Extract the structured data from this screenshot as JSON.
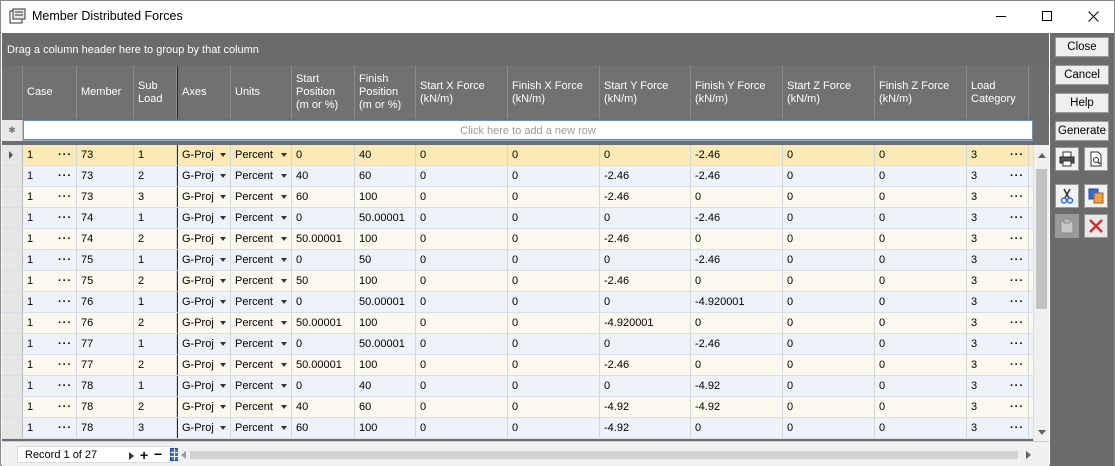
{
  "window": {
    "title": "Member Distributed Forces",
    "min_label": "—",
    "max_label": "☐",
    "close_label": "✕"
  },
  "grid": {
    "group_hint": "Drag a column header here to group by that column",
    "new_row_hint": "Click here to add a new row",
    "columns": [
      "Case",
      "Member",
      "Sub\nLoad",
      "Axes",
      "Units",
      "Start\nPosition\n(m or %)",
      "Finish\nPosition\n(m or %)",
      "Start X Force\n(kN/m)",
      "Finish X Force\n(kN/m)",
      "Start Y Force\n(kN/m)",
      "Finish Y Force\n(kN/m)",
      "Start Z Force\n(kN/m)",
      "Finish Z Force\n(kN/m)",
      "Load\nCategory"
    ],
    "rows": [
      [
        "1",
        "73",
        "1",
        "G-Proj",
        "Percent",
        "0",
        "40",
        "0",
        "0",
        "0",
        "-2.46",
        "0",
        "0",
        "3"
      ],
      [
        "1",
        "73",
        "2",
        "G-Proj",
        "Percent",
        "40",
        "60",
        "0",
        "0",
        "-2.46",
        "-2.46",
        "0",
        "0",
        "3"
      ],
      [
        "1",
        "73",
        "3",
        "G-Proj",
        "Percent",
        "60",
        "100",
        "0",
        "0",
        "-2.46",
        "0",
        "0",
        "0",
        "3"
      ],
      [
        "1",
        "74",
        "1",
        "G-Proj",
        "Percent",
        "0",
        "50.00001",
        "0",
        "0",
        "0",
        "-2.46",
        "0",
        "0",
        "3"
      ],
      [
        "1",
        "74",
        "2",
        "G-Proj",
        "Percent",
        "50.00001",
        "100",
        "0",
        "0",
        "-2.46",
        "0",
        "0",
        "0",
        "3"
      ],
      [
        "1",
        "75",
        "1",
        "G-Proj",
        "Percent",
        "0",
        "50",
        "0",
        "0",
        "0",
        "-2.46",
        "0",
        "0",
        "3"
      ],
      [
        "1",
        "75",
        "2",
        "G-Proj",
        "Percent",
        "50",
        "100",
        "0",
        "0",
        "-2.46",
        "0",
        "0",
        "0",
        "3"
      ],
      [
        "1",
        "76",
        "1",
        "G-Proj",
        "Percent",
        "0",
        "50.00001",
        "0",
        "0",
        "0",
        "-4.920001",
        "0",
        "0",
        "3"
      ],
      [
        "1",
        "76",
        "2",
        "G-Proj",
        "Percent",
        "50.00001",
        "100",
        "0",
        "0",
        "-4.920001",
        "0",
        "0",
        "0",
        "3"
      ],
      [
        "1",
        "77",
        "1",
        "G-Proj",
        "Percent",
        "0",
        "50.00001",
        "0",
        "0",
        "0",
        "-2.46",
        "0",
        "0",
        "3"
      ],
      [
        "1",
        "77",
        "2",
        "G-Proj",
        "Percent",
        "50.00001",
        "100",
        "0",
        "0",
        "-2.46",
        "0",
        "0",
        "0",
        "3"
      ],
      [
        "1",
        "78",
        "1",
        "G-Proj",
        "Percent",
        "0",
        "40",
        "0",
        "0",
        "0",
        "-4.92",
        "0",
        "0",
        "3"
      ],
      [
        "1",
        "78",
        "2",
        "G-Proj",
        "Percent",
        "40",
        "60",
        "0",
        "0",
        "-4.92",
        "-4.92",
        "0",
        "0",
        "3"
      ],
      [
        "1",
        "78",
        "3",
        "G-Proj",
        "Percent",
        "60",
        "100",
        "0",
        "0",
        "-4.92",
        "0",
        "0",
        "0",
        "3"
      ]
    ],
    "selected_row": 0
  },
  "status": {
    "record_text": "Record 1 of 27",
    "add_label": "+",
    "remove_label": "−"
  },
  "side_buttons": {
    "close": "Close",
    "cancel": "Cancel",
    "help": "Help",
    "generate": "Generate"
  },
  "colors": {
    "accent_blue": "#2f6fd6",
    "delete_red": "#d62f2f",
    "selected_row": "#fbeab5"
  }
}
